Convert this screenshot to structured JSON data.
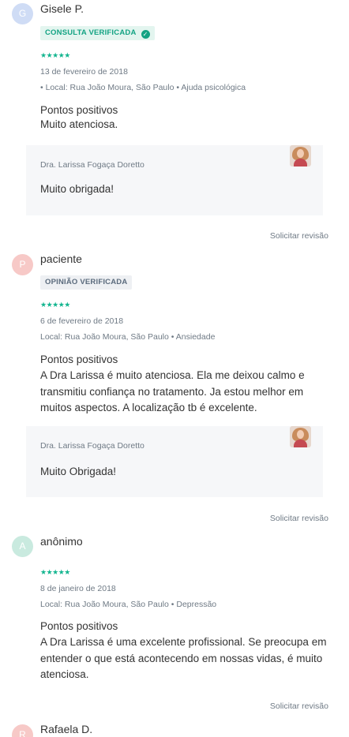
{
  "reviews": [
    {
      "initial": "G",
      "avatar_color": "#cfdcf5",
      "name": "Gisele P.",
      "badge": "CONSULTA VERIFICADA",
      "stars": "★★★★★",
      "date": "13 de fevereiro de 2018",
      "location": "• Local: Rua João Moura, São Paulo • Ajuda psicológica",
      "positives_title": "Pontos positivos",
      "positives_text": "Muito atenciosa.",
      "reply_author": "Dra. Larissa Fogaça Doretto",
      "reply_text": "Muito obrigada!",
      "request_revision": "Solicitar revisão"
    },
    {
      "initial": "P",
      "avatar_color": "#f7c9c7",
      "name": "paciente",
      "badge": "OPINIÃO VERIFICADA",
      "stars": "★★★★★",
      "date": "6 de fevereiro de 2018",
      "location": "Local: Rua João Moura, São Paulo • Ansiedade",
      "positives_title": "Pontos positivos",
      "positives_text": "A Dra Larissa é muito atenciosa. Ela me deixou calmo e transmitiu confiança no tratamento. Ja estou melhor em muitos aspectos. A localização tb é excelente.",
      "reply_author": "Dra. Larissa Fogaça Doretto",
      "reply_text": "Muito Obrigada!",
      "request_revision": "Solicitar revisão"
    },
    {
      "initial": "A",
      "avatar_color": "#c9eadf",
      "name": "anônimo",
      "stars": "★★★★★",
      "date": "8 de janeiro de 2018",
      "location": "Local: Rua João Moura, São Paulo • Depressão",
      "positives_title": "Pontos positivos",
      "positives_text": "A Dra Larissa é uma excelente profissional. Se preocupa em entender o que está acontecendo em nossas vidas, é muito atenciosa.",
      "request_revision": "Solicitar revisão"
    },
    {
      "initial": "R",
      "avatar_color": "#f7c9c7",
      "name": "Rafaela D."
    }
  ]
}
